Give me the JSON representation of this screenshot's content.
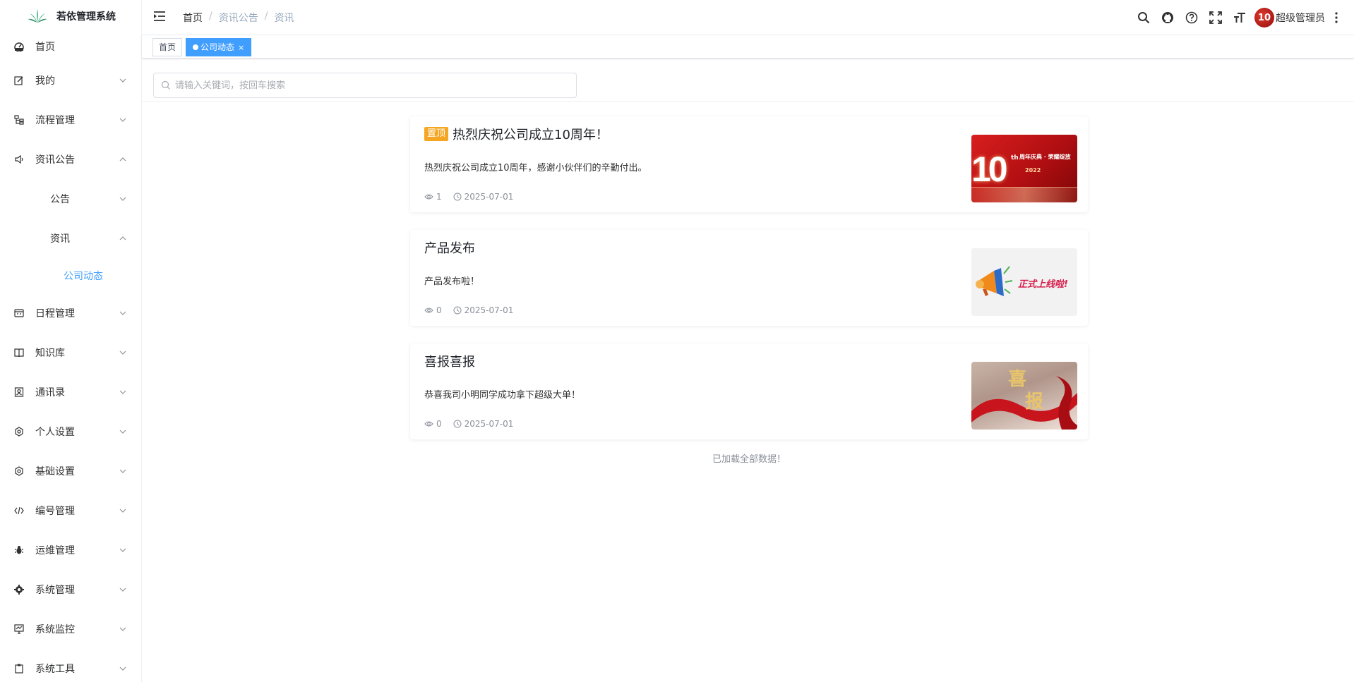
{
  "app": {
    "title": "若依管理系统"
  },
  "sidebar": {
    "items": [
      {
        "label": "首页",
        "icon": "dashboard-icon",
        "chevron": ""
      },
      {
        "label": "我的",
        "icon": "edit-icon",
        "chevron": "down"
      },
      {
        "label": "流程管理",
        "icon": "tree-icon",
        "chevron": "down"
      },
      {
        "label": "资讯公告",
        "icon": "speaker-icon",
        "chevron": "up"
      },
      {
        "label": "公告",
        "icon": "",
        "chevron": "down"
      },
      {
        "label": "资讯",
        "icon": "",
        "chevron": "up"
      },
      {
        "label": "公司动态",
        "icon": "",
        "chevron": ""
      },
      {
        "label": "日程管理",
        "icon": "calendar-icon",
        "chevron": "down"
      },
      {
        "label": "知识库",
        "icon": "book-icon",
        "chevron": "down"
      },
      {
        "label": "通讯录",
        "icon": "contacts-icon",
        "chevron": "down"
      },
      {
        "label": "个人设置",
        "icon": "gear-icon",
        "chevron": "down"
      },
      {
        "label": "基础设置",
        "icon": "gear-icon",
        "chevron": "down"
      },
      {
        "label": "编号管理",
        "icon": "code-icon",
        "chevron": "down"
      },
      {
        "label": "运维管理",
        "icon": "bug-icon",
        "chevron": "down"
      },
      {
        "label": "系统管理",
        "icon": "settings-icon",
        "chevron": "down"
      },
      {
        "label": "系统监控",
        "icon": "monitor-icon",
        "chevron": "down"
      },
      {
        "label": "系统工具",
        "icon": "tool-icon",
        "chevron": "down"
      }
    ]
  },
  "header": {
    "breadcrumb": [
      "首页",
      "资讯公告",
      "资讯"
    ],
    "icons": [
      "search-icon",
      "github-icon",
      "help-icon",
      "fullscreen-icon",
      "font-size-icon"
    ],
    "user": {
      "avatar_text": "10",
      "name": "超级管理员"
    }
  },
  "tags": {
    "home": "首页",
    "active": "公司动态",
    "close": "×"
  },
  "search": {
    "placeholder": "请输入关键词，按回车搜索",
    "value": ""
  },
  "articles": [
    {
      "badge": "置顶",
      "title": "热烈庆祝公司成立10周年！",
      "summary": "热烈庆祝公司成立10周年，感谢小伙伴们的辛勤付出。",
      "views": "1",
      "date": "2025-07-01",
      "thumb": {
        "big": "10",
        "sup": "th",
        "line1": "周年庆典 · 荣耀绽放",
        "line2": "2022"
      }
    },
    {
      "badge": "",
      "title": "产品发布",
      "summary": "产品发布啦！",
      "views": "0",
      "date": "2025-07-01",
      "thumb": {
        "text": "正式上线啦!"
      }
    },
    {
      "badge": "",
      "title": "喜报喜报",
      "summary": "恭喜我司小明同学成功拿下超级大单！",
      "views": "0",
      "date": "2025-07-01",
      "thumb": {
        "text1": "喜",
        "text2": "报"
      }
    }
  ],
  "footer": {
    "loaded": "已加载全部数据！"
  }
}
